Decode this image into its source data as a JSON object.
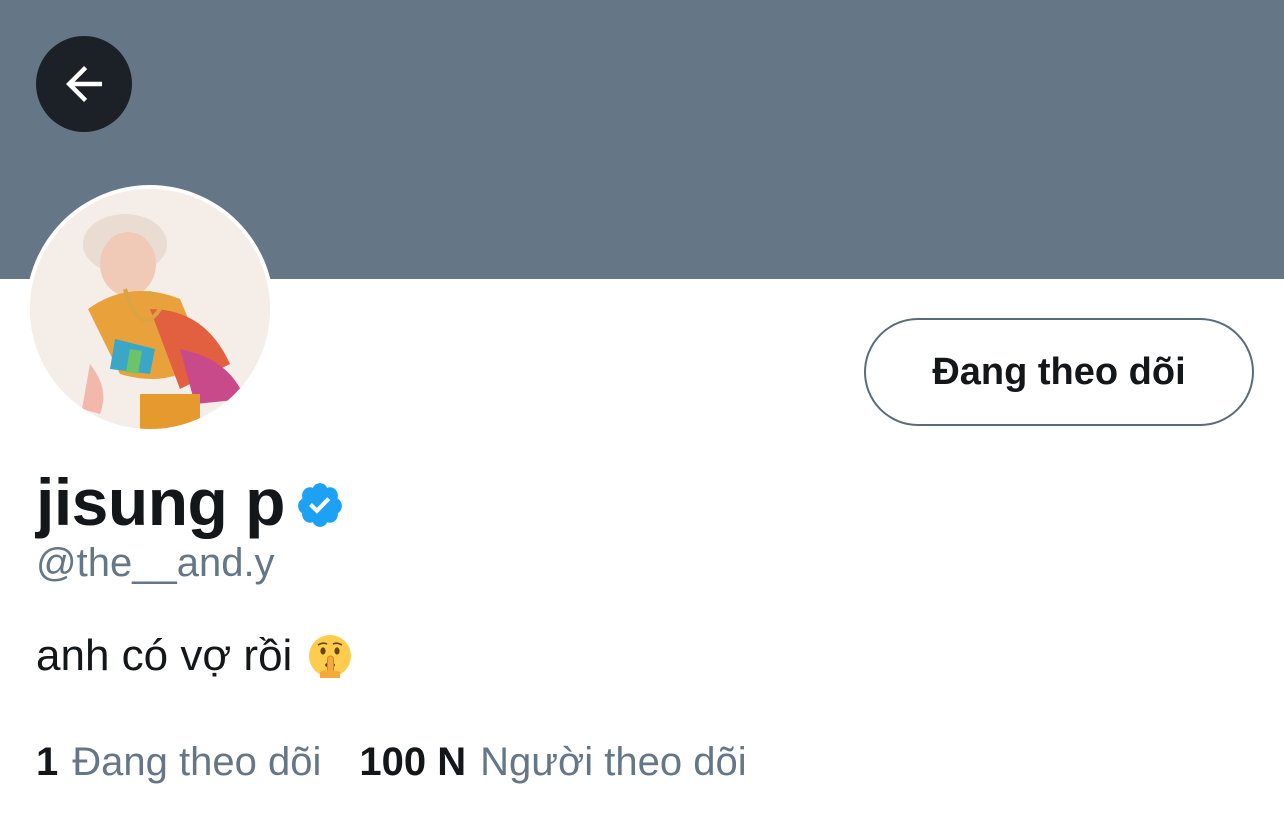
{
  "header": {
    "back_icon": "arrow-left-icon"
  },
  "profile": {
    "display_name": "jisung p",
    "verified_icon": "verified-badge-icon",
    "handle": "@the__and.y",
    "bio": "anh có vợ rồi",
    "bio_emoji": "shushing-face-emoji",
    "follow_button_label": "Đang theo dõi"
  },
  "stats": [
    {
      "count": "1",
      "label": "Đang theo dõi"
    },
    {
      "count": "100 N",
      "label": "Người theo dõi"
    }
  ],
  "colors": {
    "banner": "#657786",
    "text": "#14171a",
    "secondary_text": "#657786",
    "verified": "#1da1f2"
  }
}
